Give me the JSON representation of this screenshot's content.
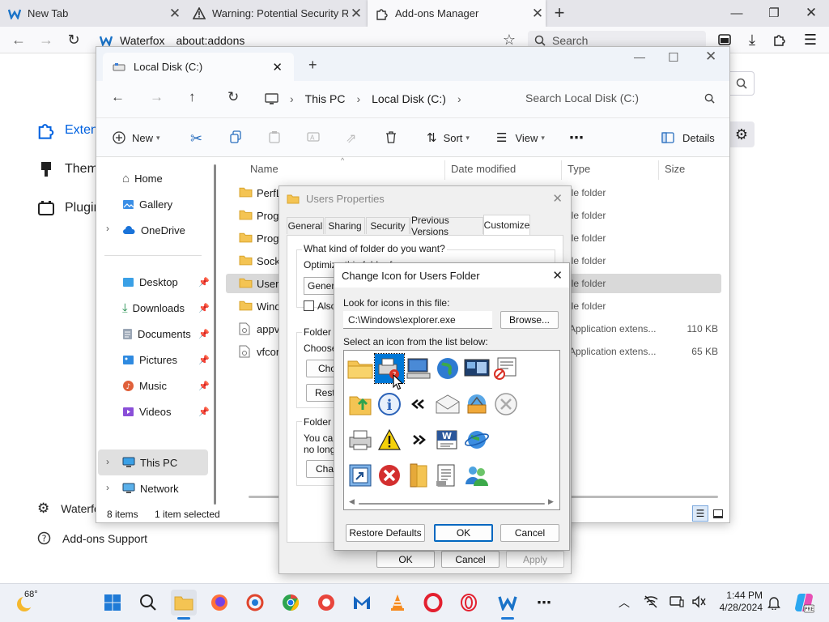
{
  "browser": {
    "tabs": [
      {
        "title": "New Tab"
      },
      {
        "title": "Warning: Potential Security Risk Ahe"
      },
      {
        "title": "Add-ons Manager"
      }
    ],
    "new_tab_symbol": "+",
    "identity": "Waterfox",
    "url": "about:addons",
    "search_placeholder": "Search"
  },
  "addons_page": {
    "nav": [
      {
        "label": "Extensions",
        "icon": "puzzle-icon"
      },
      {
        "label": "Themes",
        "icon": "brush-icon"
      },
      {
        "label": "Plugins",
        "icon": "plugin-icon"
      }
    ],
    "footer": [
      {
        "label": "Waterfox Settings",
        "icon": "gear-icon"
      },
      {
        "label": "Add-ons Support",
        "icon": "help-icon"
      }
    ]
  },
  "explorer": {
    "tab_title": "Local Disk (C:)",
    "breadcrumb": [
      "This PC",
      "Local Disk (C:)"
    ],
    "search_placeholder": "Search Local Disk (C:)",
    "toolbar": {
      "new": "New",
      "sort": "Sort",
      "view": "View",
      "details": "Details"
    },
    "nav_pane": [
      {
        "label": "Home",
        "icon": "home-icon"
      },
      {
        "label": "Gallery",
        "icon": "gallery-icon"
      },
      {
        "label": "OneDrive",
        "icon": "cloud-icon"
      },
      {
        "label": "Desktop",
        "icon": "desktop-icon"
      },
      {
        "label": "Downloads",
        "icon": "download-icon"
      },
      {
        "label": "Documents",
        "icon": "documents-icon"
      },
      {
        "label": "Pictures",
        "icon": "pictures-icon"
      },
      {
        "label": "Music",
        "icon": "music-icon"
      },
      {
        "label": "Videos",
        "icon": "videos-icon"
      },
      {
        "label": "This PC",
        "icon": "pc-icon"
      },
      {
        "label": "Network",
        "icon": "network-icon"
      }
    ],
    "columns": {
      "name": "Name",
      "date": "Date modified",
      "type": "Type",
      "size": "Size"
    },
    "files": [
      {
        "name": "PerfL",
        "type": "ile folder",
        "size": "",
        "kind": "folder"
      },
      {
        "name": "Progr",
        "type": "ile folder",
        "size": "",
        "kind": "folder"
      },
      {
        "name": "Progr",
        "type": "ile folder",
        "size": "",
        "kind": "folder"
      },
      {
        "name": "Socke",
        "type": "ile folder",
        "size": "",
        "kind": "folder"
      },
      {
        "name": "Users",
        "type": "ile folder",
        "size": "",
        "kind": "folder",
        "selected": true
      },
      {
        "name": "Wind",
        "type": "ile folder",
        "size": "",
        "kind": "folder"
      },
      {
        "name": "appve",
        "type": "Application extens...",
        "size": "110 KB",
        "kind": "file"
      },
      {
        "name": "vfcon",
        "type": "Application extens...",
        "size": "65 KB",
        "kind": "file"
      }
    ],
    "status_items": "8 items",
    "status_selected": "1 item selected"
  },
  "properties": {
    "title": "Users Properties",
    "tabs": [
      "General",
      "Sharing",
      "Security",
      "Previous Versions",
      "Customize"
    ],
    "active_tab": "Customize",
    "q_kind": "What kind of folder do you want?",
    "optimize": "Optimize this folder for:",
    "optimize_value": "Genera",
    "also_apply": "Also",
    "folder_pictures": "Folder p",
    "choose": "Choose",
    "choose_btn": "Choo",
    "restore_btn": "Resto",
    "folder_icons": "Folder ic",
    "you_can": "You can",
    "no_longer": "no longe",
    "change_btn": "Chan",
    "ok": "OK",
    "cancel": "Cancel",
    "apply": "Apply"
  },
  "change_icon": {
    "title": "Change Icon for Users Folder",
    "look_label": "Look for icons in this file:",
    "file_path": "C:\\Windows\\explorer.exe",
    "browse": "Browse...",
    "select_label": "Select an icon from the list below:",
    "restore_defaults": "Restore Defaults",
    "ok": "OK",
    "cancel": "Cancel",
    "icons": [
      [
        "folder-icon",
        "printer-settings-icon",
        "computer-icon",
        "globe-icon",
        "monitor-windows-icon",
        "blocked-window-icon"
      ],
      [
        "folder-up-arrow-icon",
        "info-icon",
        "double-left-arrow-icon",
        "envelope-icon",
        "network-share-icon",
        "circle-x-icon"
      ],
      [
        "printer-icon",
        "warning-icon",
        "double-right-arrow-icon",
        "word-document-icon",
        "internet-globe-icon"
      ],
      [
        "shortcut-icon",
        "red-x-icon",
        "folder-tall-icon",
        "document-list-icon",
        "users-icon"
      ]
    ]
  },
  "taskbar": {
    "weather": "68°",
    "time": "1:44 PM",
    "date": "4/28/2024"
  }
}
